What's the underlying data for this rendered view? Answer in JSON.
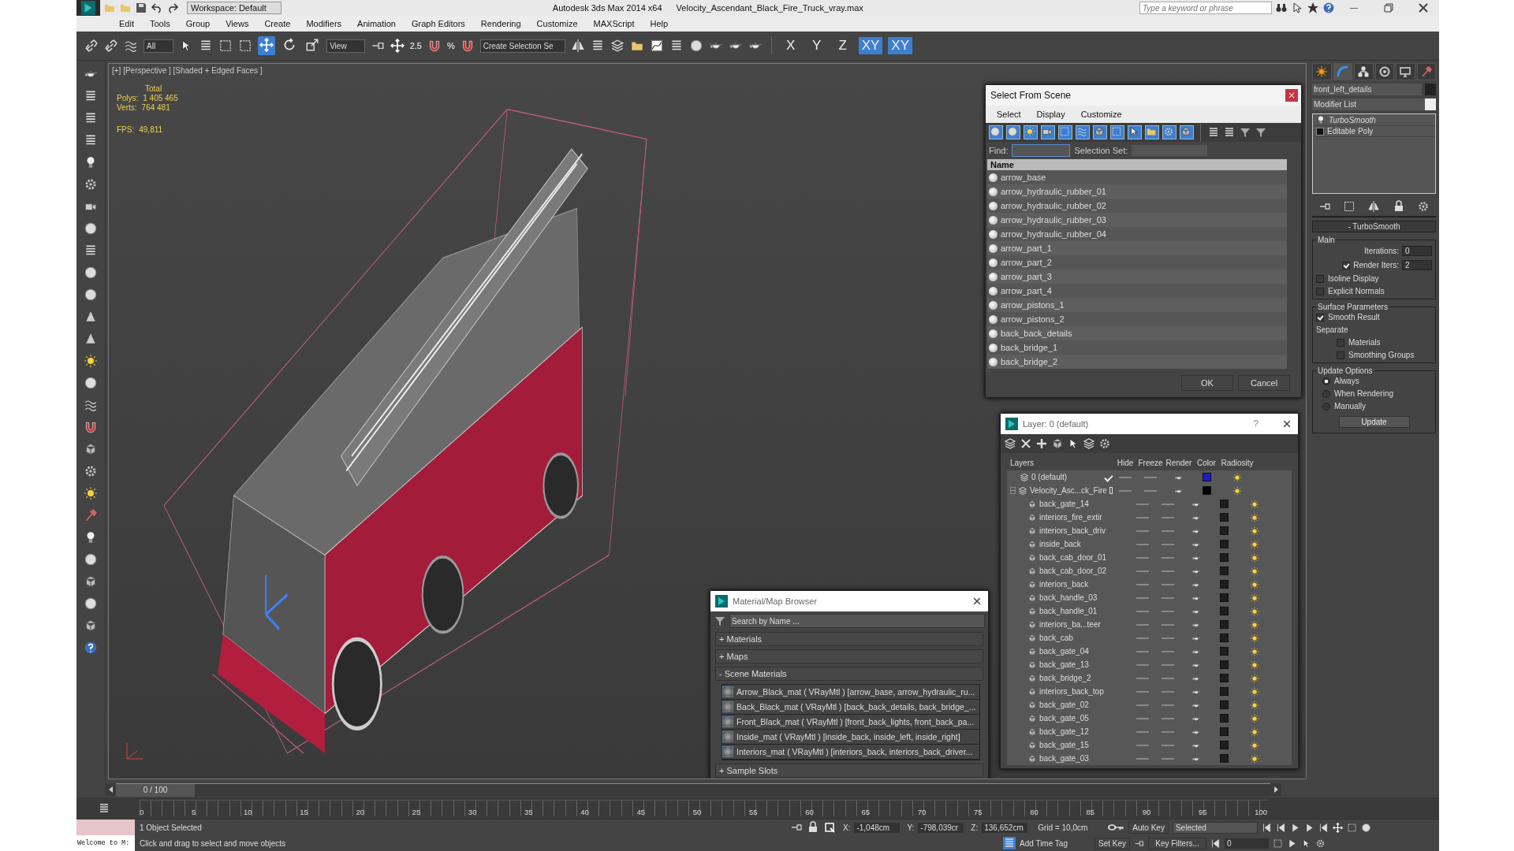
{
  "title_bar": {
    "workspace": "Workspace: Default",
    "app_name": "Autodesk 3ds Max  2014 x64",
    "file_name": "Velocity_Ascendant_Black_Fire_Truck_vray.max",
    "search": {
      "placeholder": "Type a keyword or phrase"
    }
  },
  "menu": [
    "Edit",
    "Tools",
    "Group",
    "Views",
    "Create",
    "Modifiers",
    "Animation",
    "Graph Editors",
    "Rendering",
    "Customize",
    "MAXScript",
    "Help"
  ],
  "toolbar": {
    "selection_filter": "All",
    "reference_coord": "View",
    "snaps": [
      {
        "label": "2.5"
      },
      {
        "label": "%"
      }
    ],
    "named_selection": "Create Selection Se",
    "axis_buttons": [
      {
        "label": "X",
        "selected": false
      },
      {
        "label": "Y",
        "selected": false
      },
      {
        "label": "Z",
        "selected": false
      },
      {
        "label": "XY",
        "selected": true
      },
      {
        "label": "XY",
        "selected": true
      }
    ]
  },
  "viewport": {
    "label": "[+] [Perspective ] [Shaded + Edged Faces ]",
    "stats": [
      {
        "label": "Total"
      },
      {
        "label": "Polys:",
        "value": "1 405 465"
      },
      {
        "label": "Verts:",
        "value": "764 481"
      },
      {
        "label": "FPS:",
        "value": "49,811"
      }
    ]
  },
  "select_from_scene": {
    "title": "Select From Scene",
    "menu": [
      "Select",
      "Display",
      "Customize"
    ],
    "find_label": "Find:",
    "selection_set_label": "Selection Set:",
    "column": "Name",
    "items": [
      "arrow_base",
      "arrow_hydraulic_rubber_01",
      "arrow_hydraulic_rubber_02",
      "arrow_hydraulic_rubber_03",
      "arrow_hydraulic_rubber_04",
      "arrow_part_1",
      "arrow_part_2",
      "arrow_part_3",
      "arrow_part_4",
      "arrow_pistons_1",
      "arrow_pistons_2",
      "back_back_details",
      "back_bridge_1",
      "back_bridge_2"
    ],
    "buttons": [
      "OK",
      "Cancel"
    ]
  },
  "layer_manager": {
    "title": "Layer: 0 (default)",
    "help": "?",
    "columns": [
      "Layers",
      "Hide",
      "Freeze",
      "Render",
      "Color",
      "Radiosity"
    ],
    "layers": [
      {
        "name": "0 (default)",
        "kind": "layer",
        "current": true,
        "color": "#1c1cc8"
      },
      {
        "name": "Velocity_Asc...ck_Fire",
        "kind": "layer",
        "current": false,
        "expanded": true,
        "color": "#000000",
        "children": [
          {
            "name": "back_gate_14",
            "kind": "object",
            "color": "#1e1e1e"
          },
          {
            "name": "interiors_fire_extir",
            "kind": "object",
            "color": "#1e1e1e"
          },
          {
            "name": "interiors_back_driv",
            "kind": "object",
            "color": "#1e1e1e"
          },
          {
            "name": "inside_back",
            "kind": "object",
            "color": "#1e1e1e"
          },
          {
            "name": "back_cab_door_01",
            "kind": "object",
            "color": "#1e1e1e"
          },
          {
            "name": "back_cab_door_02",
            "kind": "object",
            "color": "#1e1e1e"
          },
          {
            "name": "interiors_back",
            "kind": "object",
            "color": "#1e1e1e"
          },
          {
            "name": "back_handle_03",
            "kind": "object",
            "color": "#1e1e1e"
          },
          {
            "name": "back_handle_01",
            "kind": "object",
            "color": "#1e1e1e"
          },
          {
            "name": "interiors_ba...teer",
            "kind": "object",
            "color": "#1e1e1e"
          },
          {
            "name": "back_cab",
            "kind": "object",
            "color": "#1e1e1e"
          },
          {
            "name": "back_gate_04",
            "kind": "object",
            "color": "#1e1e1e"
          },
          {
            "name": "back_gate_13",
            "kind": "object",
            "color": "#1e1e1e"
          },
          {
            "name": "back_bridge_2",
            "kind": "object",
            "color": "#1e1e1e"
          },
          {
            "name": "interiors_back_top",
            "kind": "object",
            "color": "#1e1e1e"
          },
          {
            "name": "back_gate_02",
            "kind": "object",
            "color": "#1e1e1e"
          },
          {
            "name": "back_gate_05",
            "kind": "object",
            "color": "#1e1e1e"
          },
          {
            "name": "back_gate_12",
            "kind": "object",
            "color": "#1e1e1e"
          },
          {
            "name": "back_gate_15",
            "kind": "object",
            "color": "#1e1e1e"
          },
          {
            "name": "back_gate_03",
            "kind": "object",
            "color": "#1e1e1e"
          }
        ]
      }
    ]
  },
  "material_browser": {
    "title": "Material/Map Browser",
    "search": {
      "placeholder": "Search by Name ..."
    },
    "sections": [
      {
        "sign": "+",
        "label": "Materials"
      },
      {
        "sign": "+",
        "label": "Maps"
      },
      {
        "sign": "-",
        "label": "Scene Materials",
        "items": [
          "Arrow_Black_mat  ( VRayMtl ) [arrow_base, arrow_hydraulic_ru...",
          "Back_Black_mat ( VRayMtl ) [back_back_details, back_bridge_...",
          "Front_Black_mat  ( VRayMtl ) [front_back_lights, front_back_pa...",
          "Inside_mat  ( VRayMtl ) [inside_back, inside_left, inside_right]",
          "Interiors_mat ( VRayMtl ) [interiors_back, interiors_back_driver..."
        ]
      },
      {
        "sign": "+",
        "label": "Sample Slots"
      }
    ]
  },
  "command_panel": {
    "tabs": [
      {
        "kind": "create",
        "selected": false
      },
      {
        "kind": "modify",
        "selected": true
      },
      {
        "kind": "hierarchy",
        "selected": false
      },
      {
        "kind": "motion",
        "selected": false
      },
      {
        "kind": "display",
        "selected": false
      },
      {
        "kind": "utilities",
        "selected": false
      }
    ],
    "object_name": "front_left_details",
    "modifier_list": "Modifier List",
    "stack": [
      {
        "name": "TurboSmooth",
        "kind": "modifier"
      },
      {
        "name": "Editable Poly",
        "kind": "base"
      }
    ],
    "rollout": {
      "title": "TurboSmooth",
      "sign": "-",
      "main": {
        "label": "Main",
        "iterations": {
          "label": "Iterations:",
          "value": "0"
        },
        "render_iters": {
          "label": "Render Iters:",
          "value": "2",
          "checked": true
        },
        "options": [
          {
            "label": "Isoline Display",
            "checked": false
          },
          {
            "label": "Explicit Normals",
            "checked": false
          }
        ]
      },
      "surface": {
        "label": "Surface Parameters",
        "smooth_result": {
          "label": "Smooth Result",
          "checked": true
        },
        "separate_label": "Separate",
        "separate": [
          {
            "label": "Materials",
            "checked": false
          },
          {
            "label": "Smoothing Groups",
            "checked": false
          }
        ]
      },
      "update": {
        "label": "Update Options",
        "radios": [
          {
            "label": "Always",
            "selected": true
          },
          {
            "label": "When Rendering",
            "selected": false
          },
          {
            "label": "Manually",
            "selected": false
          }
        ],
        "button": "Update"
      }
    }
  },
  "timeline": {
    "slider": "0 / 100",
    "ticks": [
      "0",
      "5",
      "10",
      "15",
      "20",
      "25",
      "30",
      "35",
      "40",
      "45",
      "50",
      "55",
      "60",
      "65",
      "70",
      "75",
      "80",
      "85",
      "90",
      "95",
      "100"
    ]
  },
  "status_bar": {
    "listener": "Welcome to M:",
    "selection": "1 Object Selected",
    "prompt": "Click and drag to select and move objects",
    "coords": [
      {
        "label": "X:",
        "value": "-1,048cm"
      },
      {
        "label": "Y:",
        "value": "-798,039cr"
      },
      {
        "label": "Z:",
        "value": "136,652cm"
      }
    ],
    "grid": "Grid = 10,0cm",
    "add_time_tag": "Add Time Tag",
    "auto_key": "Auto Key",
    "set_key": "Set Key",
    "key_mode": "Selected",
    "key_filters": "Key Filters...",
    "frame": "0"
  }
}
